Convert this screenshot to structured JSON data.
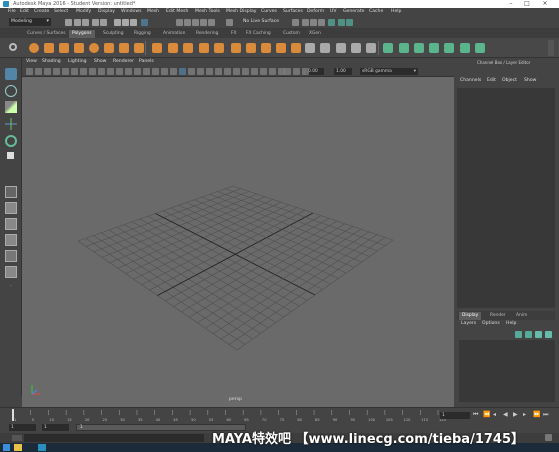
{
  "window": {
    "title": "Autodesk Maya 2016 - Student Version: untitled*"
  },
  "menubar": {
    "items": [
      "File",
      "Edit",
      "Create",
      "Select",
      "Modify",
      "Display",
      "Windows",
      "Mesh",
      "Edit Mesh",
      "Mesh Tools",
      "Mesh Display",
      "Curves",
      "Surfaces",
      "Deform",
      "UV",
      "Generate",
      "Cache",
      "Help"
    ]
  },
  "statusline": {
    "mode": "Modeling",
    "live_surface": "No Live Surface"
  },
  "shelf": {
    "tabs": [
      "Curves / Surfaces",
      "Polygons",
      "Sculpting",
      "Rigging",
      "Animation",
      "Rendering",
      "FX",
      "FX Caching",
      "Custom",
      "XGen"
    ],
    "active_tab": "Polygons"
  },
  "viewport": {
    "menus": [
      "View",
      "Shading",
      "Lighting",
      "Show",
      "Renderer",
      "Panels"
    ],
    "near_value": "0.00",
    "far_value": "1.00",
    "color_space": "sRGB gamma",
    "camera_label": "persp"
  },
  "channel_box": {
    "header": "Channel Box / Layer Editor",
    "menus": [
      "Channels",
      "Edit",
      "Object",
      "Show"
    ]
  },
  "layer_editor": {
    "tabs": [
      "Display",
      "Render",
      "Anim"
    ],
    "menus": [
      "Layers",
      "Options",
      "Help"
    ]
  },
  "timeline": {
    "ticks": [
      "1",
      "5",
      "10",
      "15",
      "20",
      "25",
      "30",
      "35",
      "40",
      "45",
      "50",
      "55",
      "60",
      "65",
      "70",
      "75",
      "80",
      "85",
      "90",
      "95",
      "100",
      "105",
      "110",
      "115",
      "120"
    ],
    "current_frame": "1"
  },
  "range": {
    "start": "1",
    "inner_start": "1",
    "slider_value": "1"
  },
  "watermark": "MAYA特效吧 【www.linecg.com/tieba/1745】",
  "colors": {
    "bg": "#444444",
    "viewport": "#6a6a6a",
    "accent": "#5285a6",
    "shelf_orange": "#d98a3a"
  }
}
